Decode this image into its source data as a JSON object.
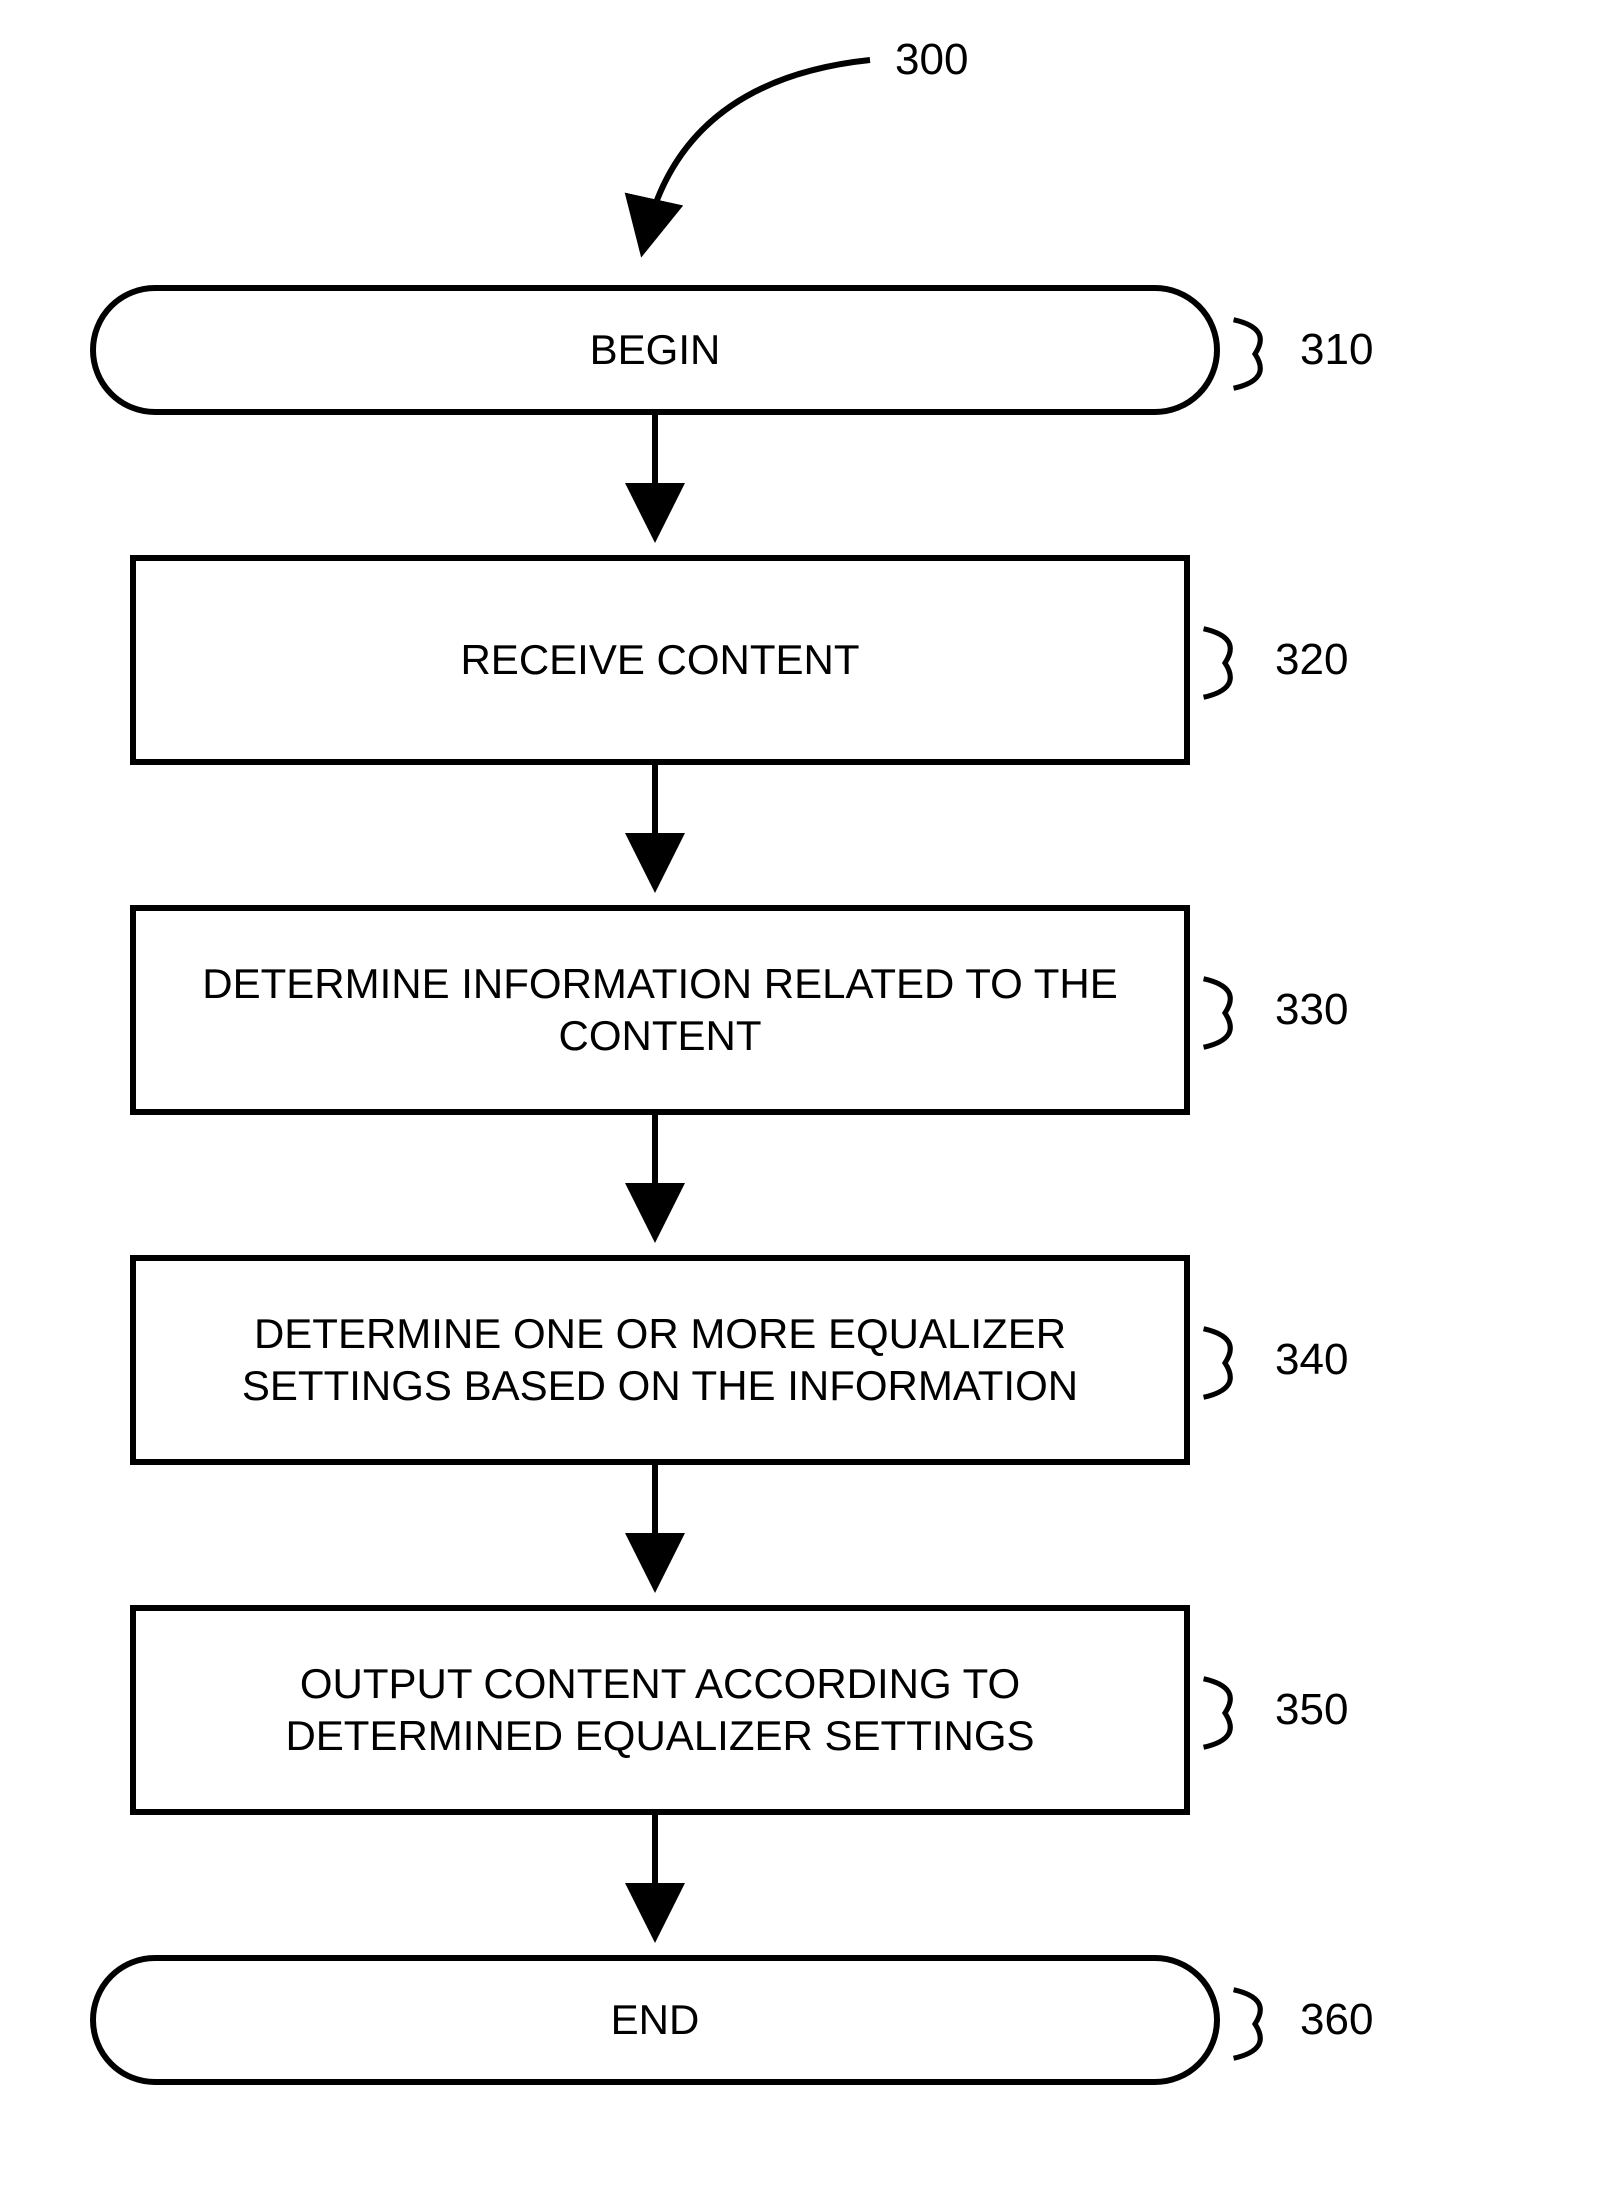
{
  "figure_ref": "300",
  "steps": [
    {
      "id": "begin",
      "label": "BEGIN",
      "ref": "310",
      "type": "terminal"
    },
    {
      "id": "s320",
      "label": "RECEIVE CONTENT",
      "ref": "320",
      "type": "process"
    },
    {
      "id": "s330",
      "label": "DETERMINE INFORMATION RELATED TO THE CONTENT",
      "ref": "330",
      "type": "process"
    },
    {
      "id": "s340",
      "label": "DETERMINE ONE OR MORE EQUALIZER SETTINGS BASED ON THE INFORMATION",
      "ref": "340",
      "type": "process"
    },
    {
      "id": "s350",
      "label": "OUTPUT CONTENT ACCORDING TO DETERMINED EQUALIZER SETTINGS",
      "ref": "350",
      "type": "process"
    },
    {
      "id": "end",
      "label": "END",
      "ref": "360",
      "type": "terminal"
    }
  ]
}
